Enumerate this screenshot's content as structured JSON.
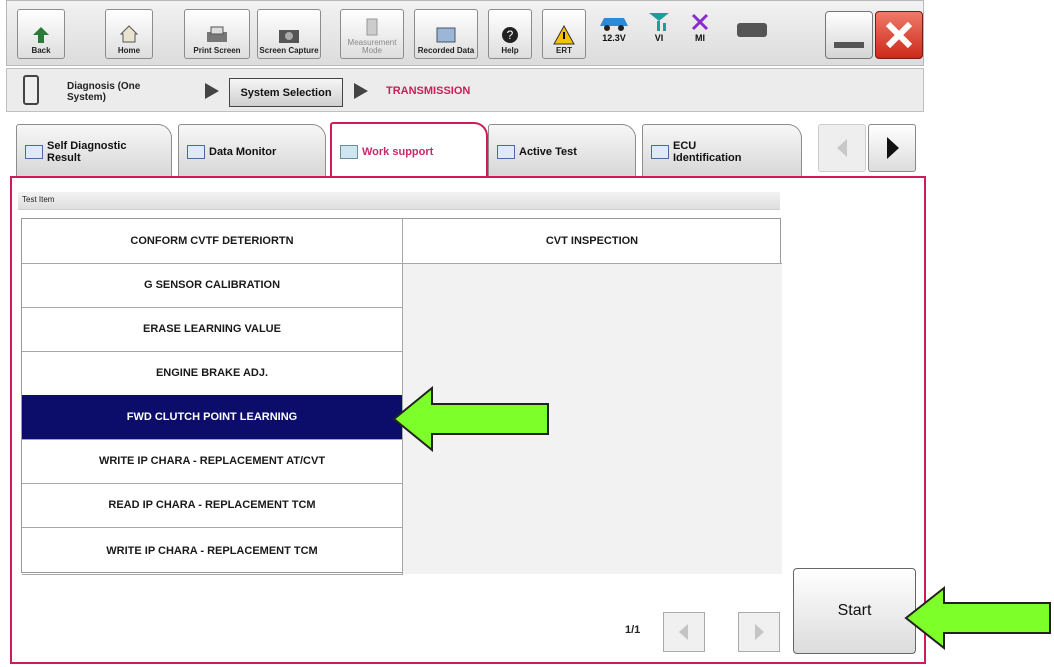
{
  "toolbar": {
    "back": "Back",
    "home": "Home",
    "print_screen": "Print Screen",
    "screen_capture": "Screen Capture",
    "measurement_mode": "Measurement Mode",
    "recorded_data": "Recorded Data",
    "help": "Help",
    "ert": "ERT",
    "voltage": "12.3V",
    "vi": "VI",
    "mi": "MI"
  },
  "breadcrumb": {
    "first": "Diagnosis (One System)",
    "system_selection": "System Selection",
    "current": "TRANSMISSION"
  },
  "tabs": [
    {
      "label": "Self Diagnostic Result"
    },
    {
      "label": "Data Monitor"
    },
    {
      "label": "Work support"
    },
    {
      "label": "Active Test"
    },
    {
      "label": "ECU Identification"
    }
  ],
  "table": {
    "header": "Test Item",
    "left_items": [
      "CONFORM CVTF DETERIORTN",
      "G SENSOR CALIBRATION",
      "ERASE LEARNING VALUE",
      "ENGINE BRAKE ADJ.",
      "FWD CLUTCH POINT LEARNING",
      "WRITE IP CHARA - REPLACEMENT AT/CVT",
      "READ IP CHARA - REPLACEMENT TCM",
      "WRITE IP CHARA - REPLACEMENT TCM"
    ],
    "right_items": [
      "CVT INSPECTION"
    ]
  },
  "pager": {
    "text": "1/1"
  },
  "start_button": {
    "label": "Start"
  },
  "colors": {
    "accent": "#cc1d58",
    "selected": "#0c0d6a",
    "arrow": "#7dff2a"
  }
}
